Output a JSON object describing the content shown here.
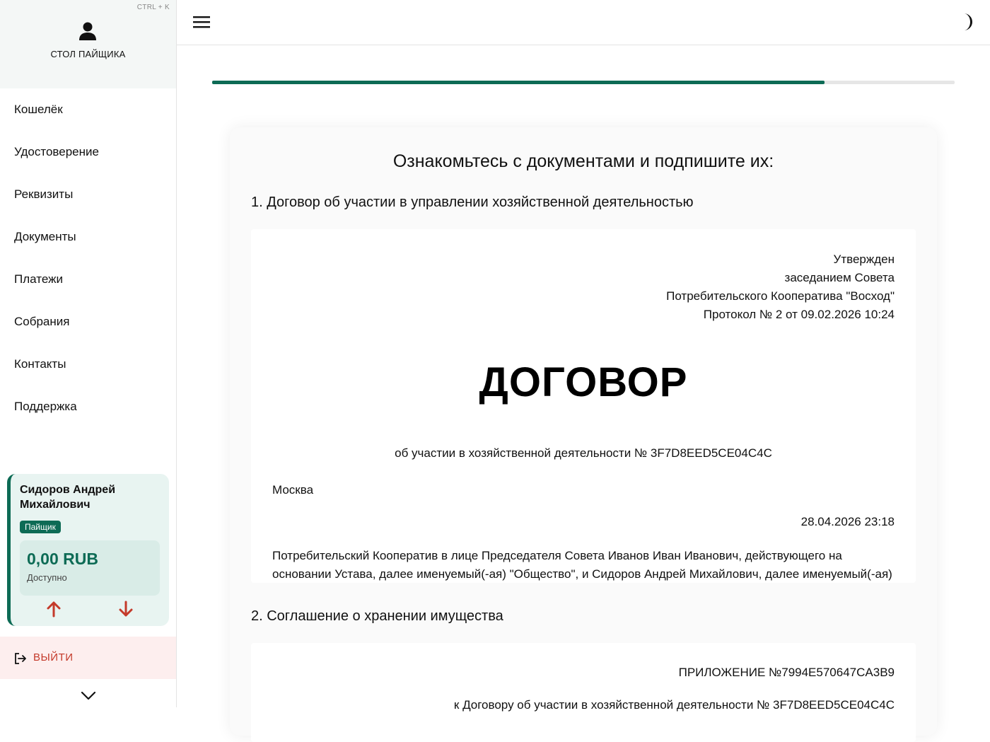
{
  "sidebar": {
    "shortcut": "CTRL + K",
    "desk_title": "СТОЛ ПАЙЩИКА",
    "nav": [
      {
        "label": "Кошелёк"
      },
      {
        "label": "Удостоверение"
      },
      {
        "label": "Реквизиты"
      },
      {
        "label": "Документы"
      },
      {
        "label": "Платежи"
      },
      {
        "label": "Собрания"
      },
      {
        "label": "Контакты"
      },
      {
        "label": "Поддержка"
      }
    ],
    "user": {
      "name": "Сидоров Андрей Михайлович",
      "role": "Пайщик",
      "balance": "0,00 RUB",
      "balance_label": "Доступно"
    },
    "logout_label": "ВЫЙТИ"
  },
  "progress": {
    "fraction": 0.825
  },
  "colors": {
    "accent": "#0d6b55",
    "danger": "#c43a2a",
    "logout_bg": "#fdeeee"
  },
  "main": {
    "title": "Ознакомьтесь с документами и подпишите их:",
    "doc1": {
      "heading": "1. Договор об участии в управлении хозяйственной деятельностью",
      "approved": [
        "Утвержден",
        "заседанием Совета",
        "Потребительского Кооператива \"Восход\"",
        "Протокол № 2 от 09.02.2026 10:24"
      ],
      "big_title": "ДОГОВОР",
      "subtitle": "об участии в хозяйственной деятельности № 3F7D8EED5CE04C4C",
      "city": "Москва",
      "date": "28.04.2026 23:18",
      "paragraph": "Потребительский Кооператив в лице Председателя Совета Иванов Иван Иванович, действующего на основании Устава, далее именуемый(-ая) \"Общество\", и Сидоров Андрей Михайлович, далее именуемый(-ая) \"Пайщик\", заключили настоящий Договор о нижеследующем:"
    },
    "doc2": {
      "heading": "2. Соглашение о хранении имущества",
      "appendix": "ПРИЛОЖЕНИЕ №7994E570647CA3B9",
      "ref": "к Договору об участии в хозяйственной деятельности № 3F7D8EED5CE04C4C"
    }
  }
}
